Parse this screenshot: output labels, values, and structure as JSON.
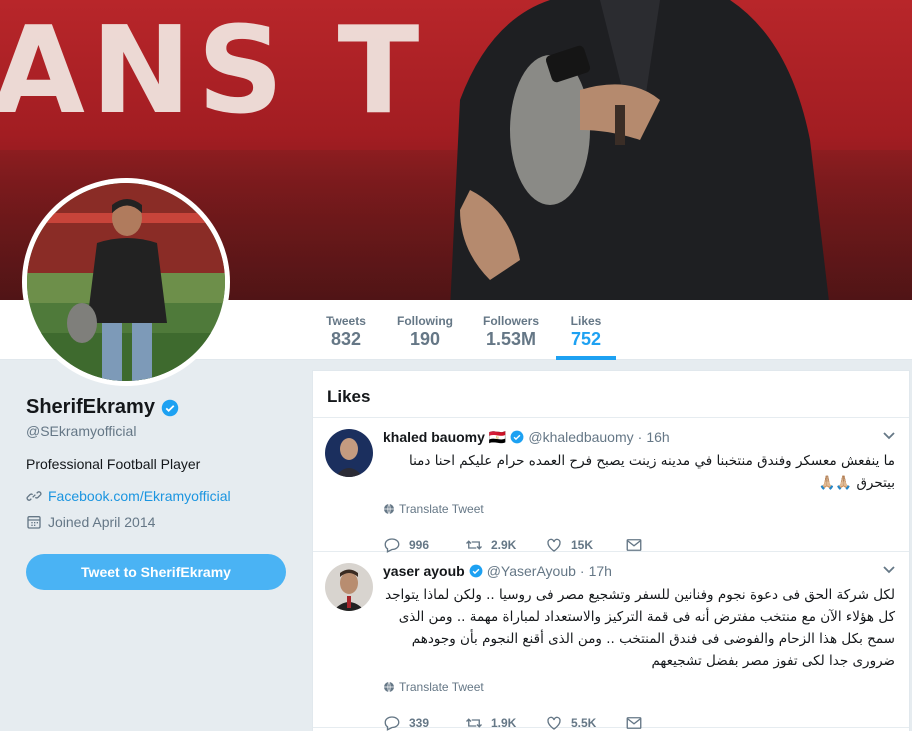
{
  "banner": {
    "text": "ANS T"
  },
  "nav": {
    "stats": [
      {
        "label": "Tweets",
        "value": "832"
      },
      {
        "label": "Following",
        "value": "190"
      },
      {
        "label": "Followers",
        "value": "1.53M"
      },
      {
        "label": "Likes",
        "value": "752"
      }
    ]
  },
  "profile": {
    "name": "SherifEkramy",
    "handle": "@SEkramyofficial",
    "bio": "Professional Football Player",
    "link": "Facebook.com/Ekramyofficial",
    "joined": "Joined April 2014",
    "tweet_to": "Tweet to SherifEkramy"
  },
  "timeline": {
    "title": "Likes",
    "tweets": [
      {
        "name": "khaled bauomy",
        "flag": "🇪🇬",
        "handle": "@khaledbauomy",
        "time": "16h",
        "text": "ما ينفعش معسكر وفندق منتخبنا في مدينه زينت يصبح فرح العمده حرام عليكم احنا دمنا بيتحرق 🙏🏼🙏🏼",
        "translate": "Translate Tweet",
        "replies": "996",
        "retweets": "2.9K",
        "likes": "15K"
      },
      {
        "name": "yaser ayoub",
        "handle": "@YaserAyoub",
        "time": "17h",
        "text": "لكل شركة الحق فى دعوة نجوم وفنانين للسفر وتشجيع مصر فى روسيا .. ولكن لماذا يتواجد كل هؤلاء الآن مع منتخب مفترض أنه فى قمة التركيز والاستعداد لمباراة مهمة .. ومن الذى سمح بكل هذا الزحام والفوضى فى فندق المنتخب .. ومن الذى أقنع النجوم بأن وجودهم ضرورى جدا لكى تفوز مصر بفضل تشجيعهم",
        "translate": "Translate Tweet",
        "replies": "339",
        "retweets": "1.9K",
        "likes": "5.5K"
      }
    ]
  },
  "colors": {
    "accent": "#1da1f2",
    "button": "#4ab3f4",
    "muted": "#657786",
    "background": "#e6ecf0"
  }
}
